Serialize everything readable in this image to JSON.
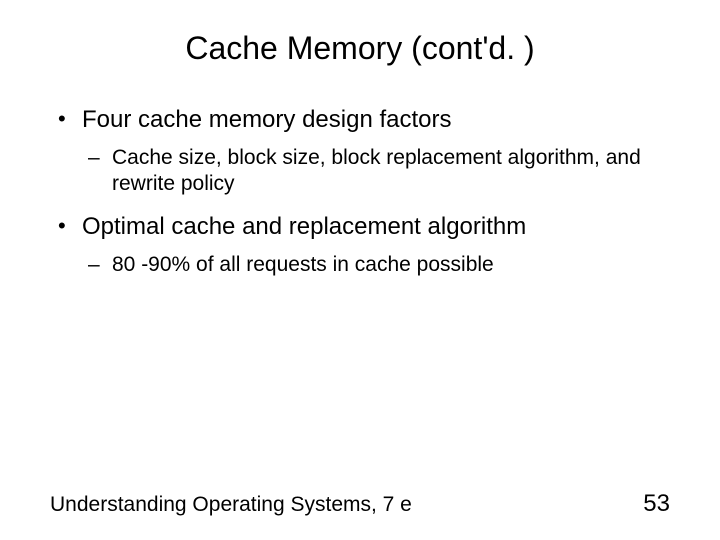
{
  "title": "Cache Memory (cont'd. )",
  "bullets": [
    {
      "text": "Four cache memory design factors",
      "sub": [
        "Cache size, block size, block replacement algorithm, and rewrite policy"
      ]
    },
    {
      "text": "Optimal cache and replacement algorithm",
      "sub": [
        "80 -90% of all requests in cache possible"
      ]
    }
  ],
  "footer": {
    "source": "Understanding Operating Systems, 7 e",
    "page": "53"
  }
}
